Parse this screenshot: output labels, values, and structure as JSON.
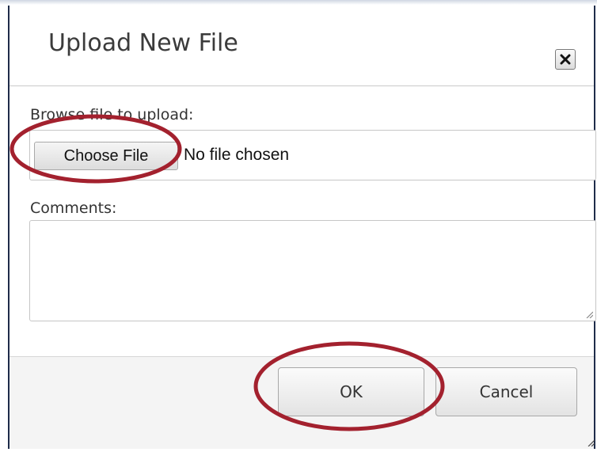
{
  "dialog": {
    "title": "Upload New File",
    "close_icon": "close-x-icon"
  },
  "file_field": {
    "label": "Browse file to upload:",
    "button_label": "Choose File",
    "status_text": "No file chosen"
  },
  "comments_field": {
    "label": "Comments:",
    "value": ""
  },
  "footer": {
    "ok_label": "OK",
    "cancel_label": "Cancel"
  },
  "annotations": {
    "color": "#a3212e",
    "highlighted": [
      "choose-file-button",
      "ok-button"
    ]
  }
}
